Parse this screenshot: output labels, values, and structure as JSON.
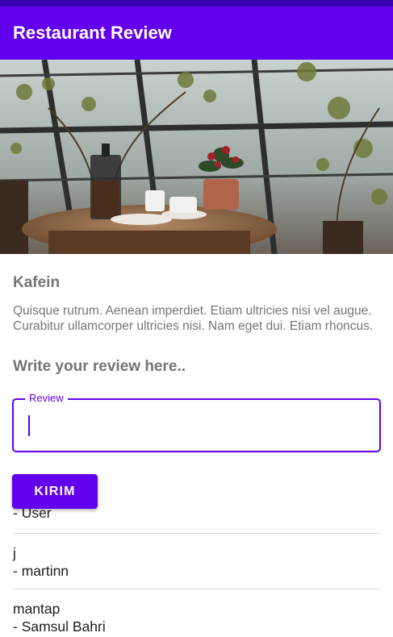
{
  "app_bar": {
    "title": "Restaurant Review"
  },
  "restaurant": {
    "name": "Kafein",
    "description": "Quisque rutrum. Aenean imperdiet. Etiam ultricies nisi vel augue. Curabitur ullamcorper ultricies nisi. Nam eget dui. Etiam rhoncus."
  },
  "review_form": {
    "heading": "Write your review here..",
    "field_label": "Review",
    "value": "",
    "submit_label": "KIRIM"
  },
  "reviews": [
    {
      "text": "",
      "author": "- User"
    },
    {
      "text": "j",
      "author": "- martinn"
    },
    {
      "text": "mantap",
      "author": "- Samsul Bahri"
    }
  ],
  "colors": {
    "primary": "#6200EE",
    "primary_dark": "#3700B3",
    "secondary_text": "#757575"
  }
}
